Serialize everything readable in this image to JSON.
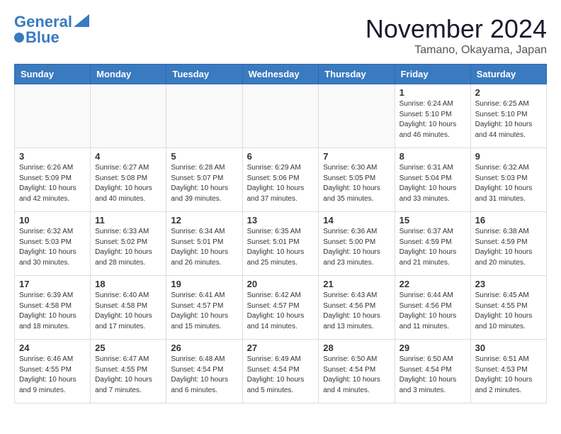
{
  "header": {
    "logo_line1": "General",
    "logo_line2": "Blue",
    "month_title": "November 2024",
    "location": "Tamano, Okayama, Japan"
  },
  "weekdays": [
    "Sunday",
    "Monday",
    "Tuesday",
    "Wednesday",
    "Thursday",
    "Friday",
    "Saturday"
  ],
  "weeks": [
    [
      {
        "day": "",
        "info": ""
      },
      {
        "day": "",
        "info": ""
      },
      {
        "day": "",
        "info": ""
      },
      {
        "day": "",
        "info": ""
      },
      {
        "day": "",
        "info": ""
      },
      {
        "day": "1",
        "info": "Sunrise: 6:24 AM\nSunset: 5:10 PM\nDaylight: 10 hours\nand 46 minutes."
      },
      {
        "day": "2",
        "info": "Sunrise: 6:25 AM\nSunset: 5:10 PM\nDaylight: 10 hours\nand 44 minutes."
      }
    ],
    [
      {
        "day": "3",
        "info": "Sunrise: 6:26 AM\nSunset: 5:09 PM\nDaylight: 10 hours\nand 42 minutes."
      },
      {
        "day": "4",
        "info": "Sunrise: 6:27 AM\nSunset: 5:08 PM\nDaylight: 10 hours\nand 40 minutes."
      },
      {
        "day": "5",
        "info": "Sunrise: 6:28 AM\nSunset: 5:07 PM\nDaylight: 10 hours\nand 39 minutes."
      },
      {
        "day": "6",
        "info": "Sunrise: 6:29 AM\nSunset: 5:06 PM\nDaylight: 10 hours\nand 37 minutes."
      },
      {
        "day": "7",
        "info": "Sunrise: 6:30 AM\nSunset: 5:05 PM\nDaylight: 10 hours\nand 35 minutes."
      },
      {
        "day": "8",
        "info": "Sunrise: 6:31 AM\nSunset: 5:04 PM\nDaylight: 10 hours\nand 33 minutes."
      },
      {
        "day": "9",
        "info": "Sunrise: 6:32 AM\nSunset: 5:03 PM\nDaylight: 10 hours\nand 31 minutes."
      }
    ],
    [
      {
        "day": "10",
        "info": "Sunrise: 6:32 AM\nSunset: 5:03 PM\nDaylight: 10 hours\nand 30 minutes."
      },
      {
        "day": "11",
        "info": "Sunrise: 6:33 AM\nSunset: 5:02 PM\nDaylight: 10 hours\nand 28 minutes."
      },
      {
        "day": "12",
        "info": "Sunrise: 6:34 AM\nSunset: 5:01 PM\nDaylight: 10 hours\nand 26 minutes."
      },
      {
        "day": "13",
        "info": "Sunrise: 6:35 AM\nSunset: 5:01 PM\nDaylight: 10 hours\nand 25 minutes."
      },
      {
        "day": "14",
        "info": "Sunrise: 6:36 AM\nSunset: 5:00 PM\nDaylight: 10 hours\nand 23 minutes."
      },
      {
        "day": "15",
        "info": "Sunrise: 6:37 AM\nSunset: 4:59 PM\nDaylight: 10 hours\nand 21 minutes."
      },
      {
        "day": "16",
        "info": "Sunrise: 6:38 AM\nSunset: 4:59 PM\nDaylight: 10 hours\nand 20 minutes."
      }
    ],
    [
      {
        "day": "17",
        "info": "Sunrise: 6:39 AM\nSunset: 4:58 PM\nDaylight: 10 hours\nand 18 minutes."
      },
      {
        "day": "18",
        "info": "Sunrise: 6:40 AM\nSunset: 4:58 PM\nDaylight: 10 hours\nand 17 minutes."
      },
      {
        "day": "19",
        "info": "Sunrise: 6:41 AM\nSunset: 4:57 PM\nDaylight: 10 hours\nand 15 minutes."
      },
      {
        "day": "20",
        "info": "Sunrise: 6:42 AM\nSunset: 4:57 PM\nDaylight: 10 hours\nand 14 minutes."
      },
      {
        "day": "21",
        "info": "Sunrise: 6:43 AM\nSunset: 4:56 PM\nDaylight: 10 hours\nand 13 minutes."
      },
      {
        "day": "22",
        "info": "Sunrise: 6:44 AM\nSunset: 4:56 PM\nDaylight: 10 hours\nand 11 minutes."
      },
      {
        "day": "23",
        "info": "Sunrise: 6:45 AM\nSunset: 4:55 PM\nDaylight: 10 hours\nand 10 minutes."
      }
    ],
    [
      {
        "day": "24",
        "info": "Sunrise: 6:46 AM\nSunset: 4:55 PM\nDaylight: 10 hours\nand 9 minutes."
      },
      {
        "day": "25",
        "info": "Sunrise: 6:47 AM\nSunset: 4:55 PM\nDaylight: 10 hours\nand 7 minutes."
      },
      {
        "day": "26",
        "info": "Sunrise: 6:48 AM\nSunset: 4:54 PM\nDaylight: 10 hours\nand 6 minutes."
      },
      {
        "day": "27",
        "info": "Sunrise: 6:49 AM\nSunset: 4:54 PM\nDaylight: 10 hours\nand 5 minutes."
      },
      {
        "day": "28",
        "info": "Sunrise: 6:50 AM\nSunset: 4:54 PM\nDaylight: 10 hours\nand 4 minutes."
      },
      {
        "day": "29",
        "info": "Sunrise: 6:50 AM\nSunset: 4:54 PM\nDaylight: 10 hours\nand 3 minutes."
      },
      {
        "day": "30",
        "info": "Sunrise: 6:51 AM\nSunset: 4:53 PM\nDaylight: 10 hours\nand 2 minutes."
      }
    ]
  ]
}
